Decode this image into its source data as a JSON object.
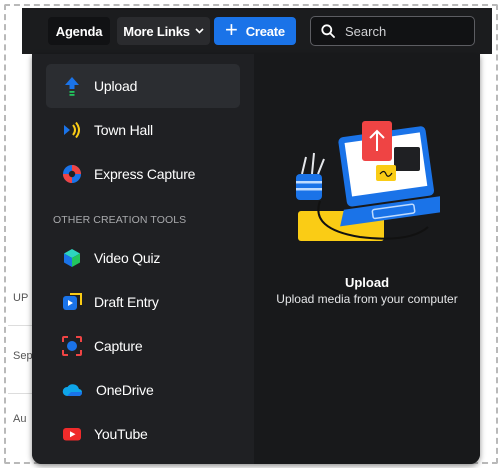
{
  "header": {
    "agenda_label": "Agenda",
    "more_links_label": "More Links",
    "create_label": "Create",
    "search_placeholder": "Search"
  },
  "background": {
    "row1": "UP",
    "row2": "Sep",
    "row3": "Au"
  },
  "menu": {
    "items": [
      {
        "label": "Upload",
        "icon": "upload-icon",
        "active": true
      },
      {
        "label": "Town Hall",
        "icon": "town-hall-icon"
      },
      {
        "label": "Express Capture",
        "icon": "express-capture-icon"
      }
    ],
    "section_label": "OTHER CREATION TOOLS",
    "other_items": [
      {
        "label": "Video Quiz",
        "icon": "video-quiz-icon"
      },
      {
        "label": "Draft Entry",
        "icon": "draft-entry-icon"
      },
      {
        "label": "Capture",
        "icon": "capture-icon"
      },
      {
        "label": "OneDrive",
        "icon": "onedrive-icon"
      },
      {
        "label": "YouTube",
        "icon": "youtube-icon"
      }
    ]
  },
  "preview": {
    "title": "Upload",
    "description": "Upload media from your computer"
  },
  "colors": {
    "accent": "#1a73e8",
    "header_bg": "#1b1c1e",
    "menu_bg": "#1f2023",
    "preview_bg": "#18191b"
  }
}
